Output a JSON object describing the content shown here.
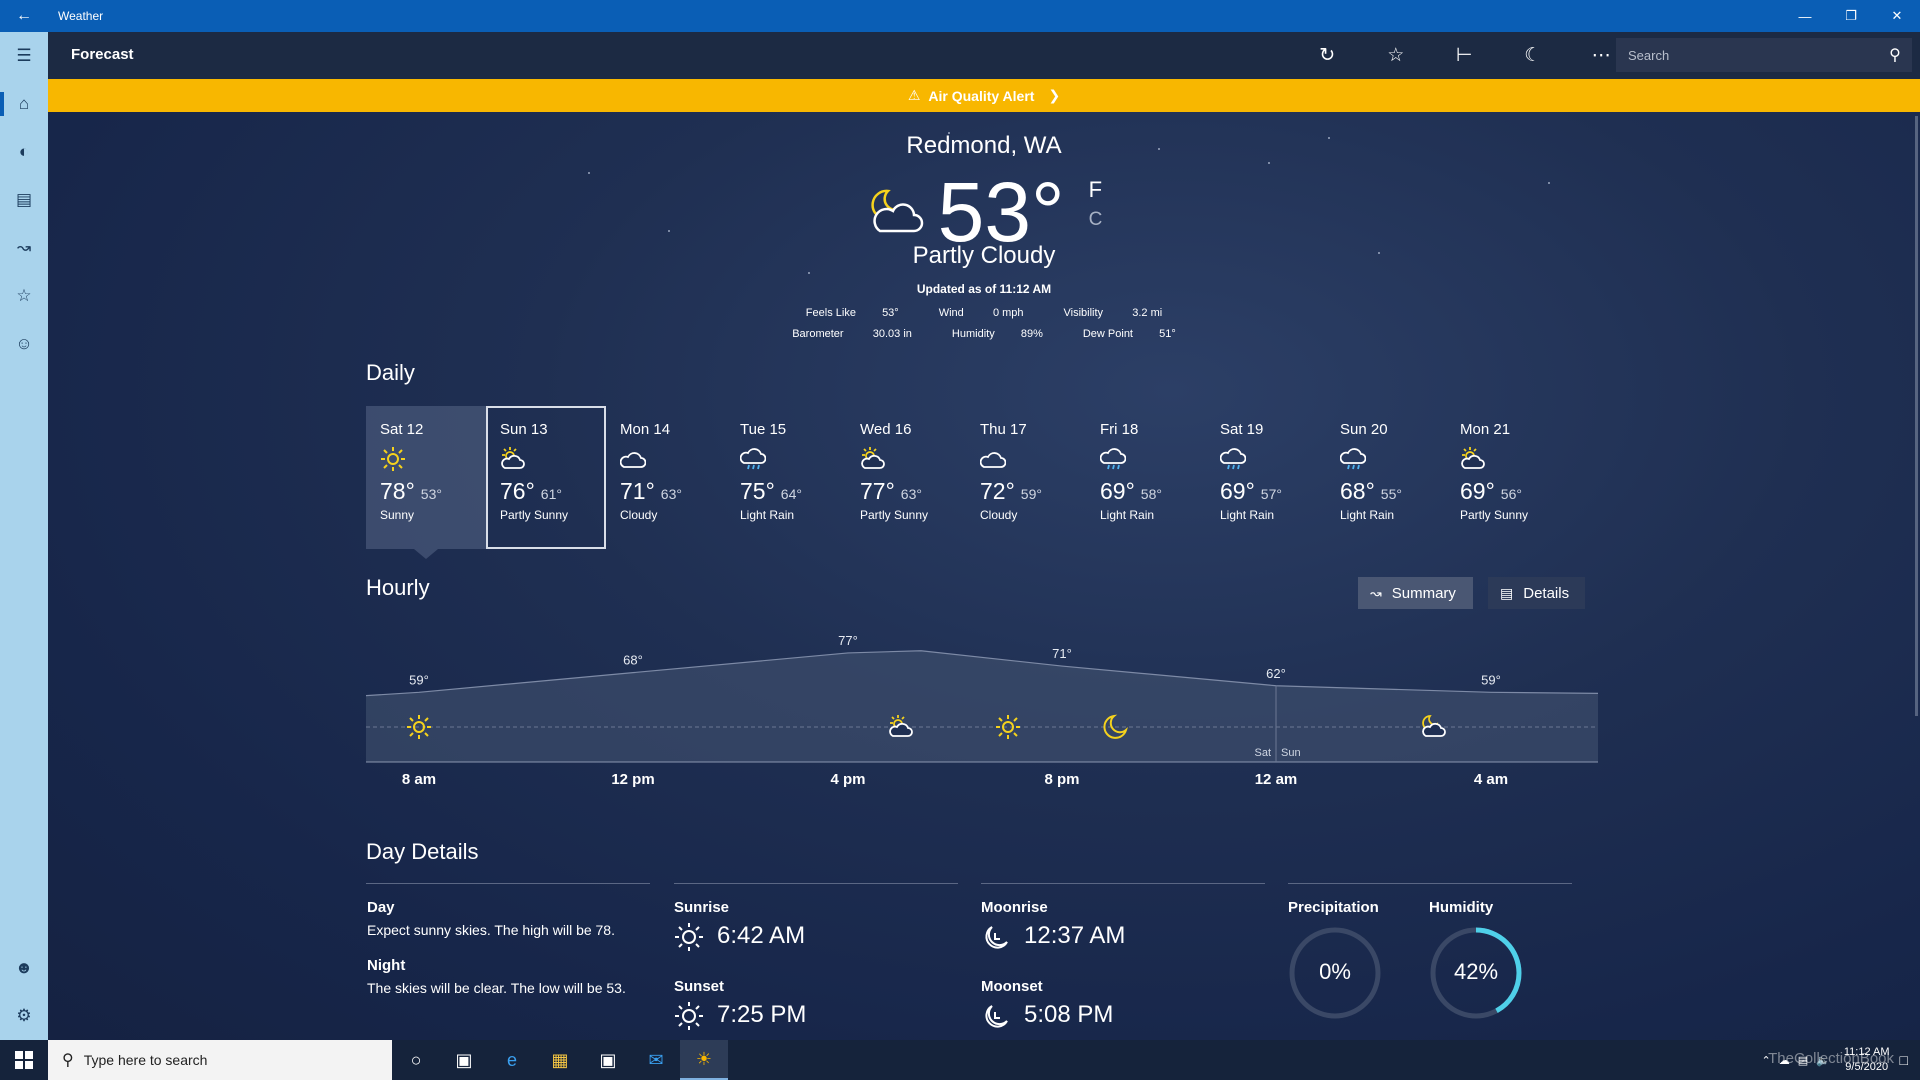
{
  "window": {
    "title": "Weather"
  },
  "command_bar": {
    "page_title": "Forecast",
    "search_placeholder": "Search"
  },
  "alert": {
    "text": "Air Quality Alert"
  },
  "current": {
    "location": "Redmond, WA",
    "temperature": "53°",
    "unit_f": "F",
    "unit_c": "C",
    "condition": "Partly Cloudy",
    "updated": "Updated as of 11:12 AM",
    "feels_like_label": "Feels Like",
    "feels_like": "53°",
    "wind_label": "Wind",
    "wind": "0 mph",
    "visibility_label": "Visibility",
    "visibility": "3.2 mi",
    "barometer_label": "Barometer",
    "barometer": "30.03 in",
    "humidity_label": "Humidity",
    "humidity": "89%",
    "dew_point_label": "Dew Point",
    "dew_point": "51°"
  },
  "daily": {
    "title": "Daily",
    "days": [
      {
        "day": "Sat 12",
        "icon": "sun-icon",
        "high": "78°",
        "low": "53°",
        "desc": "Sunny"
      },
      {
        "day": "Sun 13",
        "icon": "partly-sunny-icon",
        "high": "76°",
        "low": "61°",
        "desc": "Partly Sunny"
      },
      {
        "day": "Mon 14",
        "icon": "cloud-icon",
        "high": "71°",
        "low": "63°",
        "desc": "Cloudy"
      },
      {
        "day": "Tue 15",
        "icon": "rain-icon",
        "high": "75°",
        "low": "64°",
        "desc": "Light Rain"
      },
      {
        "day": "Wed 16",
        "icon": "partly-sunny-icon",
        "high": "77°",
        "low": "63°",
        "desc": "Partly Sunny"
      },
      {
        "day": "Thu 17",
        "icon": "cloud-icon",
        "high": "72°",
        "low": "59°",
        "desc": "Cloudy"
      },
      {
        "day": "Fri 18",
        "icon": "rain-icon",
        "high": "69°",
        "low": "58°",
        "desc": "Light Rain"
      },
      {
        "day": "Sat 19",
        "icon": "rain-icon",
        "high": "69°",
        "low": "57°",
        "desc": "Light Rain"
      },
      {
        "day": "Sun 20",
        "icon": "rain-icon",
        "high": "68°",
        "low": "55°",
        "desc": "Light Rain"
      },
      {
        "day": "Mon 21",
        "icon": "partly-sunny-icon",
        "high": "69°",
        "low": "56°",
        "desc": "Partly Sunny"
      }
    ]
  },
  "hourly": {
    "title": "Hourly",
    "summary_label": "Summary",
    "details_label": "Details",
    "day_marker_left": "Sat",
    "day_marker_right": "Sun",
    "time_labels": [
      "8 am",
      "12 pm",
      "4 pm",
      "8 pm",
      "12 am",
      "4 am"
    ],
    "temp_labels": [
      "59°",
      "68°",
      "77°",
      "71°",
      "62°",
      "59°"
    ]
  },
  "chart_data": {
    "type": "area",
    "title": "",
    "x": [
      "8 am",
      "12 pm",
      "4 pm",
      "8 pm",
      "12 am",
      "4 am"
    ],
    "series": [
      {
        "values": [
          59,
          68,
          77,
          71,
          62,
          59
        ]
      }
    ],
    "icons": [
      "sun-icon",
      "partly-sunny-icon",
      "sun-icon",
      "moon-icon",
      "partly-cloudy-night-icon"
    ],
    "xlabel": "",
    "ylabel": ""
  },
  "day_details": {
    "title": "Day Details",
    "day_label": "Day",
    "day_text": "Expect sunny skies. The high will be 78.",
    "night_label": "Night",
    "night_text": "The skies will be clear. The low will be 53.",
    "sunrise_label": "Sunrise",
    "sunrise": "6:42 AM",
    "sunset_label": "Sunset",
    "sunset": "7:25 PM",
    "moonrise_label": "Moonrise",
    "moonrise": "12:37 AM",
    "moonset_label": "Moonset",
    "moonset": "5:08 PM",
    "precipitation_label": "Precipitation",
    "precipitation": "0%",
    "precipitation_fraction": 0,
    "humidity_label": "Humidity",
    "humidity": "42%",
    "humidity_fraction": 0.42
  },
  "taskbar": {
    "search_placeholder": "Type here to search",
    "time": "11:12 AM",
    "date": "9/5/2020",
    "watermark": "TheCollectionBook"
  },
  "colors": {
    "accent": "#0a5eb5",
    "alert": "#f8b700",
    "sun": "#f5d21d",
    "gauge": "#4fd0e9"
  }
}
